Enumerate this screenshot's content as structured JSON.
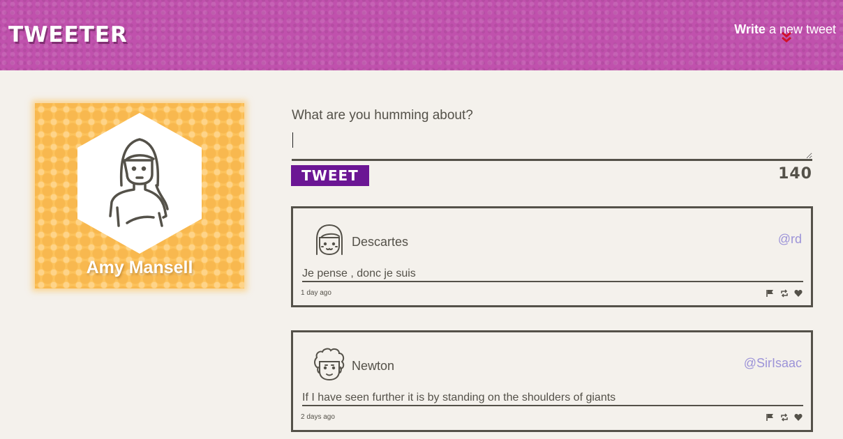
{
  "nav": {
    "brand": "TWEETER",
    "compose_bold": "Write",
    "compose_rest": "a new tweet",
    "chevron_icon": "double-chevron-down-icon"
  },
  "profile": {
    "name": "Amy Mansell",
    "avatar_icon": "woman-avatar-icon"
  },
  "composer": {
    "prompt": "What are you humming about?",
    "value": "",
    "button_label": "TWEET",
    "counter": "140"
  },
  "tweets": [
    {
      "author": "Descartes",
      "handle": "@rd",
      "content": "Je pense , donc je suis",
      "time": "1 day ago",
      "avatar_icon": "girl-avatar-icon",
      "actions": [
        "flag-icon",
        "retweet-icon",
        "heart-icon"
      ]
    },
    {
      "author": "Newton",
      "handle": "@SirIsaac",
      "content": "If I have seen further it is by standing on the shoulders of giants",
      "time": "2 days ago",
      "avatar_icon": "curly-hair-avatar-icon",
      "actions": [
        "flag-icon",
        "retweet-icon",
        "heart-icon"
      ]
    }
  ],
  "colors": {
    "nav_bg": "#c051ad",
    "profile_bg": "#fdc35c",
    "button_bg": "#6b1694",
    "handle": "#9c93d8",
    "text": "#545149",
    "page_bg": "#f4f1ec"
  }
}
